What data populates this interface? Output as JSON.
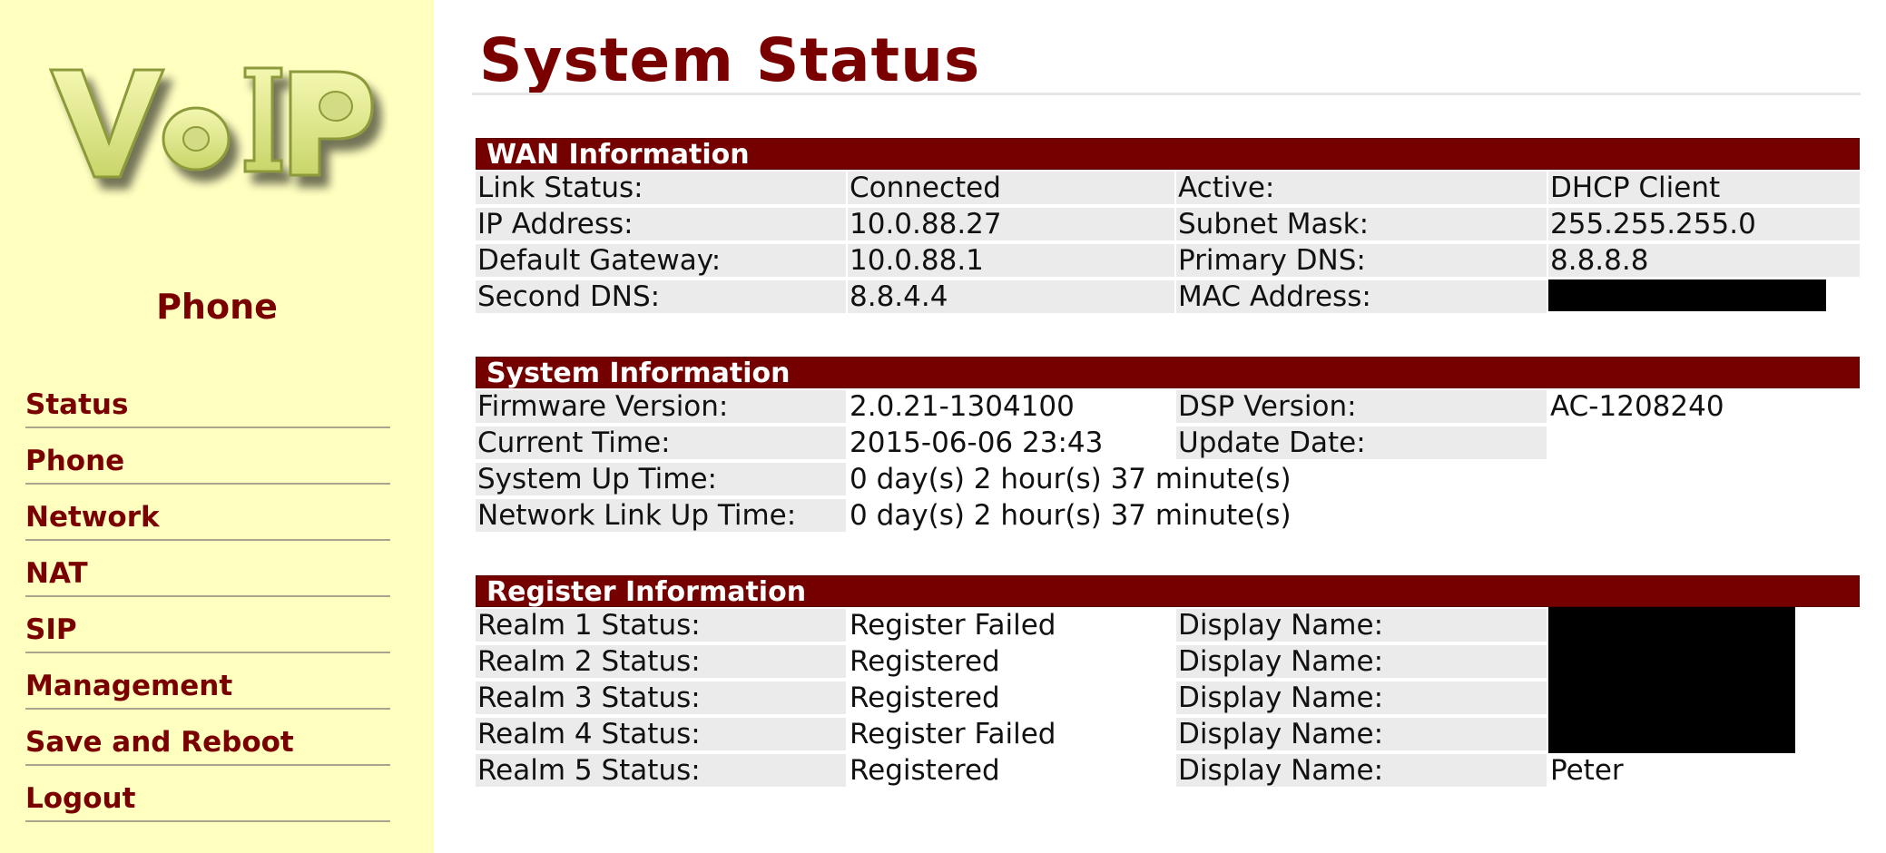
{
  "sidebar": {
    "logo_text": "VoIP",
    "heading": "Phone",
    "nav": [
      {
        "label": "Status"
      },
      {
        "label": "Phone"
      },
      {
        "label": "Network"
      },
      {
        "label": "NAT"
      },
      {
        "label": "SIP"
      },
      {
        "label": "Management"
      },
      {
        "label": "Save and Reboot"
      },
      {
        "label": "Logout"
      }
    ]
  },
  "main": {
    "title": "System Status",
    "wan": {
      "header": "WAN Information",
      "rows": [
        {
          "l1": "Link Status:",
          "v1": "Connected",
          "l2": "Active:",
          "v2": "DHCP Client"
        },
        {
          "l1": "IP Address:",
          "v1": "10.0.88.27",
          "l2": "Subnet Mask:",
          "v2": "255.255.255.0"
        },
        {
          "l1": "Default Gateway:",
          "v1": "10.0.88.1",
          "l2": "Primary DNS:",
          "v2": "8.8.8.8"
        },
        {
          "l1": "Second DNS:",
          "v1": "8.8.4.4",
          "l2": "MAC Address:",
          "v2": ""
        }
      ]
    },
    "system": {
      "header": "System Information",
      "rows": [
        {
          "l1": "Firmware Version:",
          "v1": "2.0.21-1304100",
          "l2": "DSP Version:",
          "v2": "AC-1208240"
        },
        {
          "l1": "Current Time:",
          "v1": "2015-06-06 23:43",
          "l2": "Update Date:",
          "v2": ""
        },
        {
          "l1": "System Up Time:",
          "v1": "0 day(s) 2 hour(s) 37 minute(s)"
        },
        {
          "l1": "Network Link Up Time:",
          "v1": "0 day(s) 2 hour(s) 37 minute(s)"
        }
      ]
    },
    "register": {
      "header": "Register Information",
      "rows": [
        {
          "l1": "Realm 1 Status:",
          "v1": "Register Failed",
          "l2": "Display Name:",
          "v2": ""
        },
        {
          "l1": "Realm 2 Status:",
          "v1": "Registered",
          "l2": "Display Name:",
          "v2": ""
        },
        {
          "l1": "Realm 3 Status:",
          "v1": "Registered",
          "l2": "Display Name:",
          "v2": ""
        },
        {
          "l1": "Realm 4 Status:",
          "v1": "Register Failed",
          "l2": "Display Name:",
          "v2": ""
        },
        {
          "l1": "Realm 5 Status:",
          "v1": "Registered",
          "l2": "Display Name:",
          "v2": "Peter"
        }
      ]
    }
  },
  "colors": {
    "sidebar_bg": "#ffffc0",
    "accent": "#7a0000",
    "header_bg": "#750000",
    "label_bg": "#ebebeb"
  }
}
